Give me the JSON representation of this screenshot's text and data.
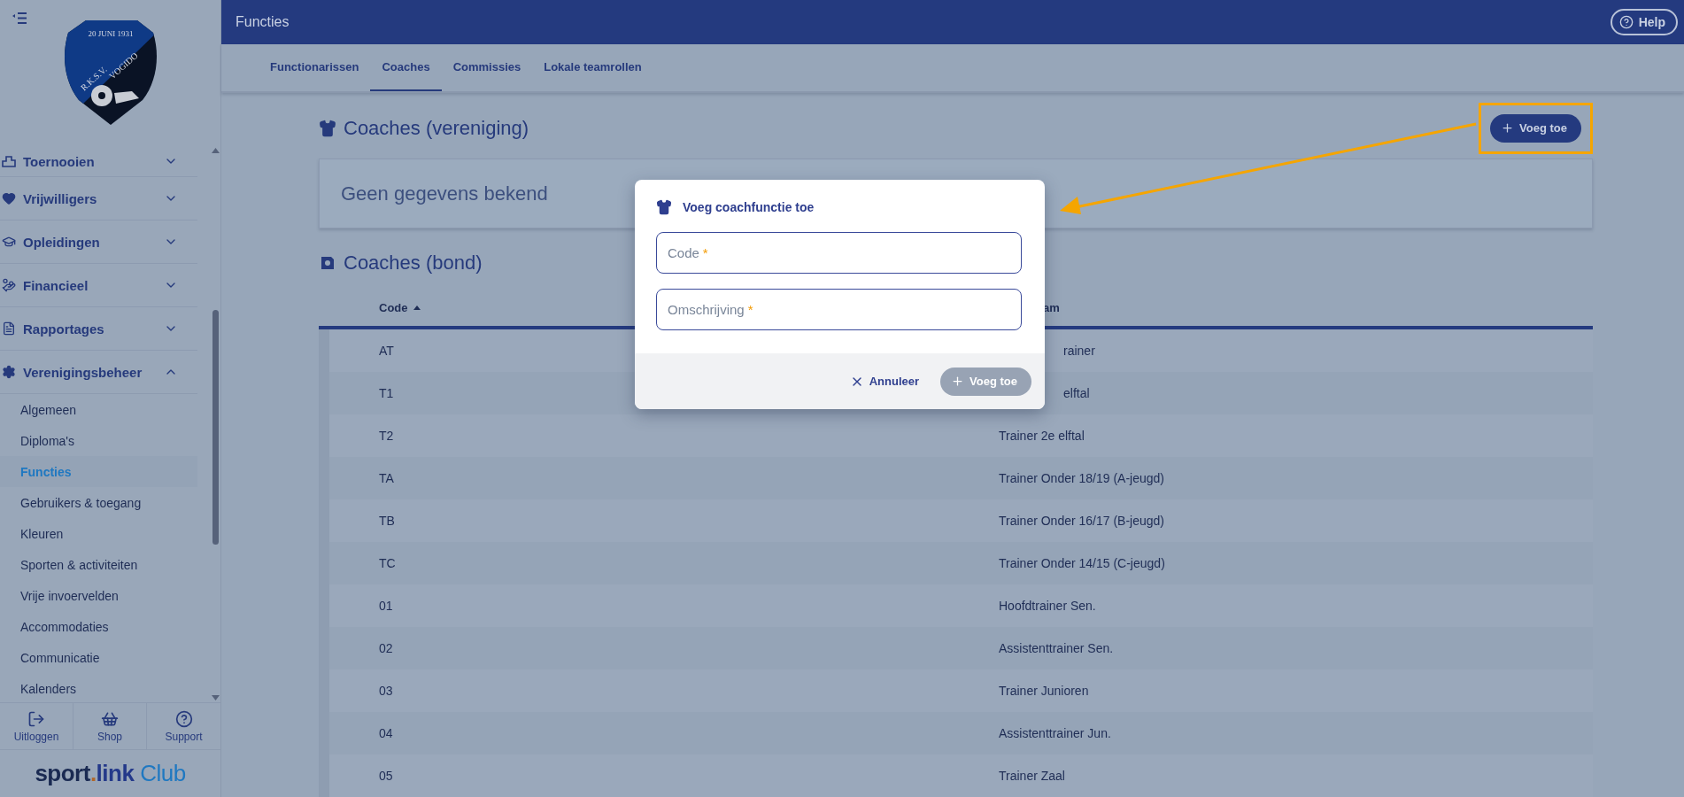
{
  "sidebar": {
    "club_logo": {
      "date": "20 JUNI 1931",
      "prefix": "R.K.S.V.",
      "name": "VOGIDO"
    },
    "menu": [
      {
        "label": "Toernooien",
        "expanded": false
      },
      {
        "label": "Vrijwilligers",
        "expanded": false
      },
      {
        "label": "Opleidingen",
        "expanded": false
      },
      {
        "label": "Financieel",
        "expanded": false
      },
      {
        "label": "Rapportages",
        "expanded": false
      },
      {
        "label": "Verenigingsbeheer",
        "expanded": true,
        "children": [
          {
            "label": "Algemeen",
            "selected": false
          },
          {
            "label": "Diploma's",
            "selected": false
          },
          {
            "label": "Functies",
            "selected": true
          },
          {
            "label": "Gebruikers & toegang",
            "selected": false
          },
          {
            "label": "Kleuren",
            "selected": false
          },
          {
            "label": "Sporten & activiteiten",
            "selected": false
          },
          {
            "label": "Vrije invoervelden",
            "selected": false
          },
          {
            "label": "Accommodaties",
            "selected": false
          },
          {
            "label": "Communicatie",
            "selected": false
          },
          {
            "label": "Kalenders",
            "selected": false
          }
        ]
      }
    ],
    "footer_buttons": [
      {
        "label": "Uitloggen"
      },
      {
        "label": "Shop"
      },
      {
        "label": "Support"
      }
    ],
    "brand": {
      "name": "sport",
      "dot": ".",
      "suffix": "link",
      "product": "Club"
    }
  },
  "header": {
    "title": "Functies",
    "help": "Help"
  },
  "tabs": [
    {
      "label": "Functionarissen",
      "selected": false
    },
    {
      "label": "Coaches",
      "selected": true
    },
    {
      "label": "Commissies",
      "selected": false
    },
    {
      "label": "Lokale teamrollen",
      "selected": false
    }
  ],
  "club_section": {
    "title": "Coaches (vereniging)",
    "add_button": "Voeg toe",
    "highlighted": true,
    "empty_text": "Geen gegevens bekend"
  },
  "bond_section": {
    "title": "Coaches (bond)",
    "columns": [
      {
        "label": "Code",
        "sorted": true,
        "covered": false
      },
      {
        "label": "am",
        "sorted": false,
        "covered": true
      }
    ],
    "rows": [
      {
        "code": "AT",
        "name": "rainer",
        "covered": true
      },
      {
        "code": "T1",
        "name": "elftal",
        "covered": true
      },
      {
        "code": "T2",
        "name": "Trainer 2e elftal",
        "covered": false
      },
      {
        "code": "TA",
        "name": "Trainer Onder 18/19 (A-jeugd)",
        "covered": false
      },
      {
        "code": "TB",
        "name": "Trainer Onder 16/17 (B-jeugd)",
        "covered": false
      },
      {
        "code": "TC",
        "name": "Trainer Onder 14/15 (C-jeugd)",
        "covered": false
      },
      {
        "code": "01",
        "name": "Hoofdtrainer Sen.",
        "covered": false
      },
      {
        "code": "02",
        "name": "Assistenttrainer Sen.",
        "covered": false
      },
      {
        "code": "03",
        "name": "Trainer Junioren",
        "covered": false
      },
      {
        "code": "04",
        "name": "Assistenttrainer Jun.",
        "covered": false
      },
      {
        "code": "05",
        "name": "Trainer Zaal",
        "covered": false
      }
    ]
  },
  "dialog": {
    "title": "Voeg coachfunctie toe",
    "fields": [
      {
        "placeholder": "Code",
        "required_mark": "*"
      },
      {
        "placeholder": "Omschrijving",
        "required_mark": "*"
      }
    ],
    "cancel": "Annuleer",
    "submit": {
      "label": "Voeg toe",
      "disabled": true
    }
  }
}
